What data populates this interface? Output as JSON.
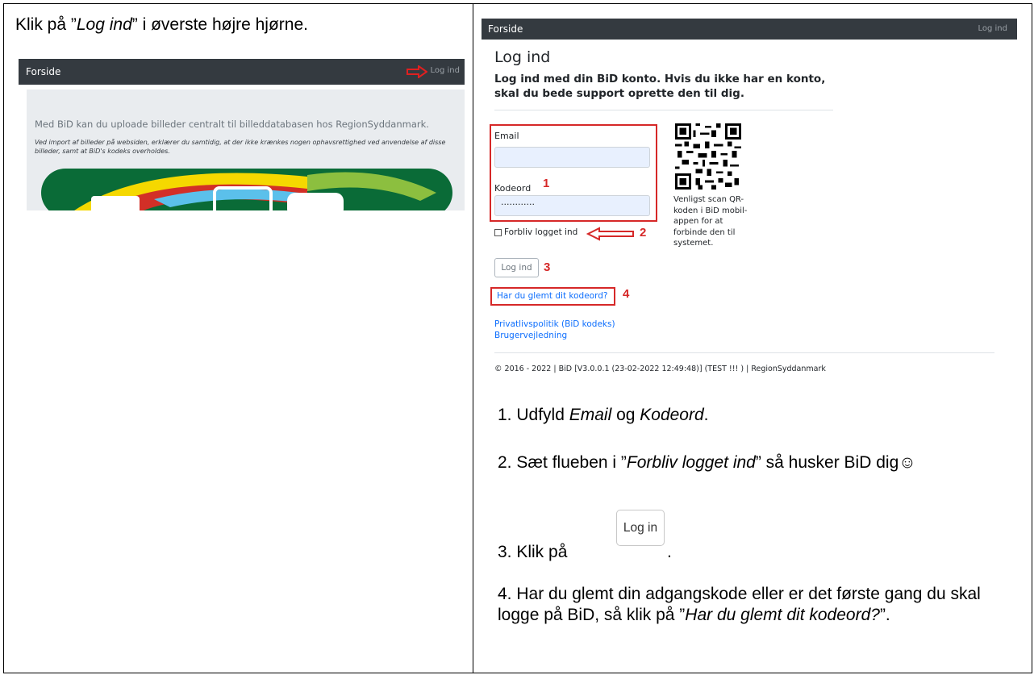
{
  "left": {
    "heading_pre": "Klik på ”",
    "heading_em": "Log ind",
    "heading_post": "” i øverste højre hjørne.",
    "shot": {
      "brand": "Forside",
      "login_link": "Log ind",
      "lead": "Med BiD kan du uploade billeder centralt til billeddatabasen hos RegionSyddanmark.",
      "notice": "Ved import af billeder på websiden, erklærer du samtidig, at der ikke krænkes nogen ophavsrettighed ved anvendelse af disse billeder, samt at BiD's kodeks overholdes."
    }
  },
  "right": {
    "shot": {
      "brand": "Forside",
      "login_link": "Log ind",
      "title": "Log ind",
      "subtitle": "Log ind med din BiD konto. Hvis du ikke har en konto, skal du bede support oprette den til dig.",
      "email_label": "Email",
      "password_label": "Kodeord",
      "password_value": "············",
      "remember_label": "Forbliv logget ind",
      "login_button": "Log ind",
      "forgot_link": "Har du glemt dit kodeord?",
      "privacy_link": "Privatlivspolitik (BiD kodeks)",
      "guide_link": "Brugervejledning",
      "footer": "© 2016 - 2022 | BiD [V3.0.0.1 (23-02-2022 12:49:48)] (TEST !!! ) | RegionSyddanmark",
      "qr_text": "Venligst scan QR-koden i BiD mobil-appen for at forbinde den til systemet.",
      "markers": [
        "1",
        "2",
        "3",
        "4"
      ]
    },
    "steps": {
      "s1_pre": "1. Udfyld ",
      "s1_em1": "Email",
      "s1_mid": " og ",
      "s1_em2": "Kodeord",
      "s1_post": ".",
      "s2_pre": "2. Sæt flueben i ”",
      "s2_em": "Forbliv logget ind",
      "s2_post": "” så husker BiD dig☺",
      "s3_pre": "3. Klik på",
      "s3_button": "Log in",
      "s3_post": ".",
      "s4_pre": "4. Har du glemt din adgangskode eller er det første gang du skal logge på BiD, så klik på ”",
      "s4_em": "Har du glemt dit kodeord?",
      "s4_post": "”."
    }
  },
  "colors": {
    "navbar": "#343a40",
    "marker_red": "#d62828",
    "link_blue": "#0d6efd",
    "input_bg": "#e8f0fe"
  }
}
